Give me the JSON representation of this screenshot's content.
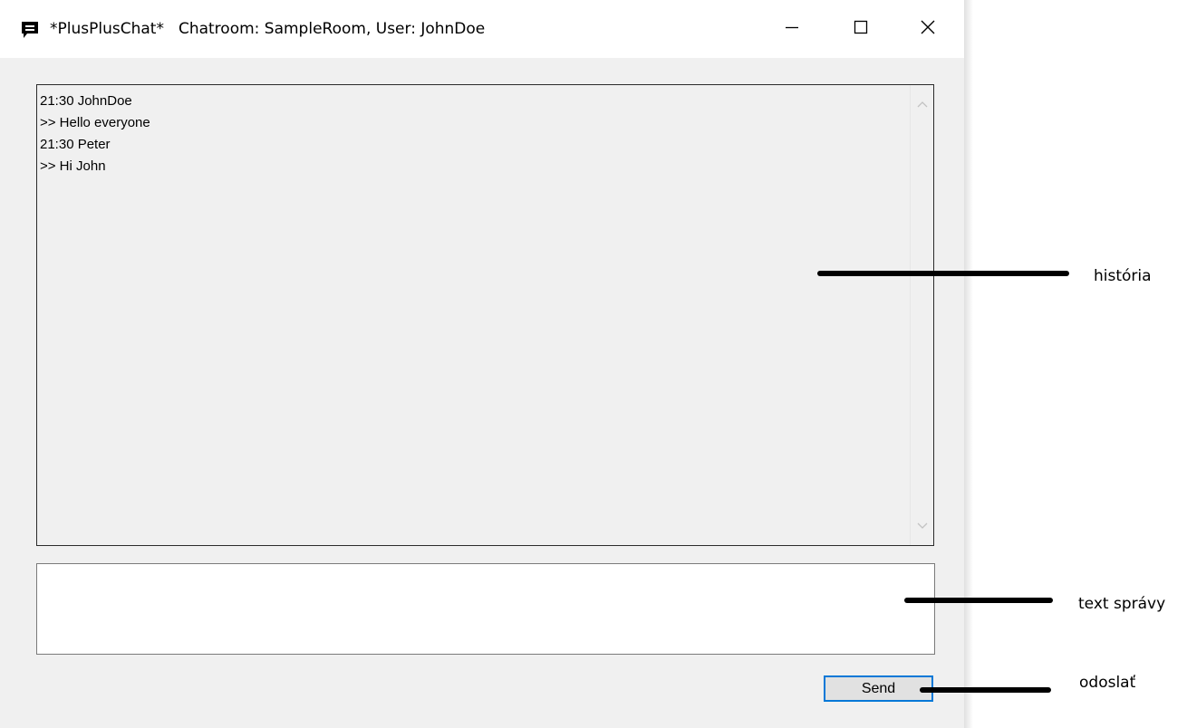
{
  "window": {
    "app_name": "*PlusPlusChat*",
    "subtitle": "Chatroom: SampleRoom, User: JohnDoe",
    "icon": "chat-bubble-icon",
    "controls": [
      "minimize-icon",
      "maximize-icon",
      "close-icon"
    ]
  },
  "history": {
    "lines": [
      "21:30 JohnDoe",
      ">> Hello everyone",
      "21:30 Peter",
      ">> Hi John"
    ]
  },
  "message_input": {
    "value": ""
  },
  "send_button": {
    "label": "Send"
  },
  "annotations": {
    "history": "história",
    "message": "text správy",
    "send": "odoslať"
  }
}
